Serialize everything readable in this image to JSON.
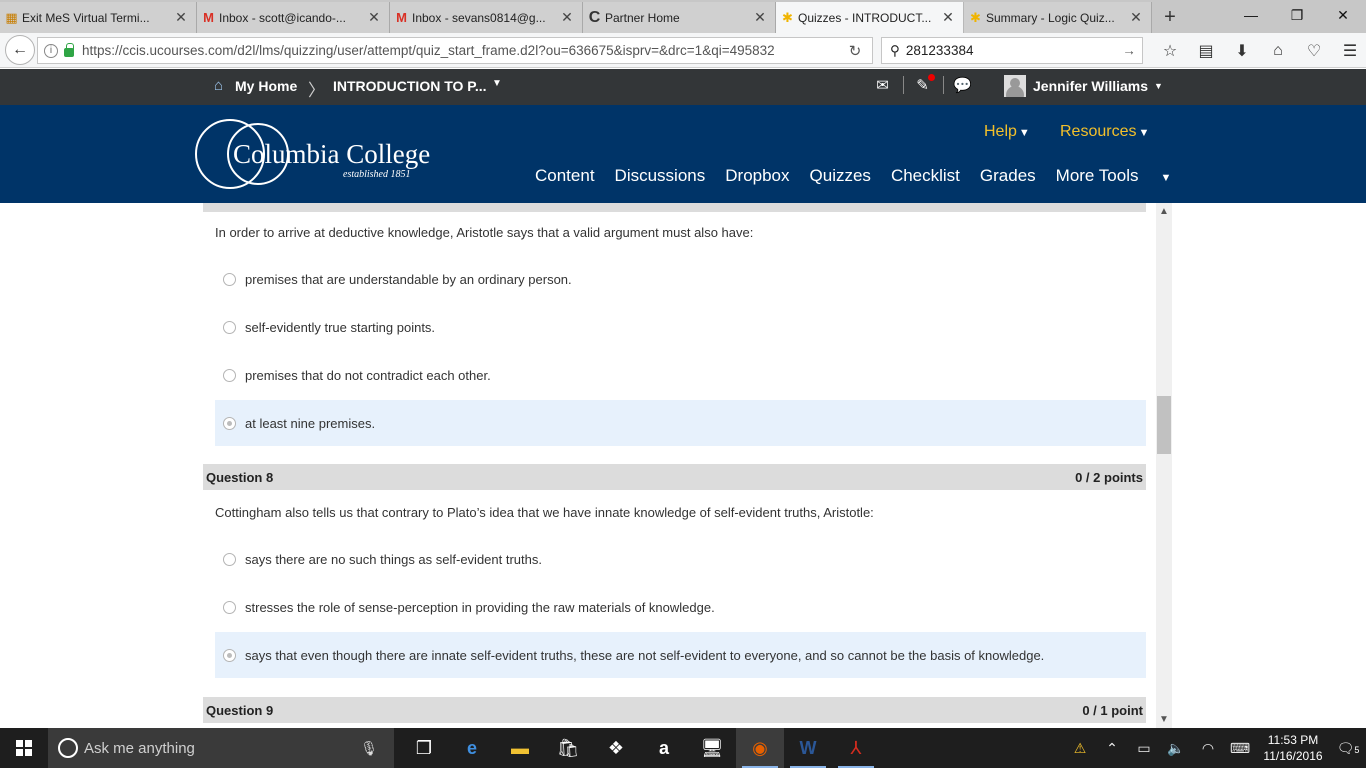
{
  "browser": {
    "tabs": [
      {
        "icon": "terminal-icon",
        "title": "Exit MeS Virtual Termi...",
        "active": false
      },
      {
        "icon": "gmail-icon",
        "title": "Inbox - scott@icando-...",
        "active": false
      },
      {
        "icon": "gmail-icon",
        "title": "Inbox - sevans0814@g...",
        "active": false
      },
      {
        "icon": "c-logo-icon",
        "title": "Partner Home",
        "active": false
      },
      {
        "icon": "d2l-icon",
        "title": "Quizzes - INTRODUCT...",
        "active": true
      },
      {
        "icon": "d2l-icon",
        "title": "Summary - Logic Quiz...",
        "active": false
      }
    ],
    "url": "https://ccis.ucourses.com/d2l/lms/quizzing/user/attempt/quiz_start_frame.d2l?ou=636675&isprv=&drc=1&qi=495832",
    "search_value": "281233384"
  },
  "minibar": {
    "home_label": "My Home",
    "course_label": "INTRODUCTION TO P...",
    "user_name": "Jennifer Williams"
  },
  "header": {
    "logo_text": "Columbia College",
    "logo_sub": "established 1851",
    "help_label": "Help",
    "resources_label": "Resources",
    "nav": [
      "Content",
      "Discussions",
      "Dropbox",
      "Quizzes",
      "Checklist",
      "Grades",
      "More Tools"
    ]
  },
  "quiz": {
    "q7": {
      "text": "In order to arrive at deductive knowledge, Aristotle says that a valid argument must also have:",
      "options": [
        "premises that are understandable by an ordinary person.",
        "self-evidently true starting points.",
        "premises that do not contradict each other.",
        "at least nine premises."
      ],
      "selected_index": 3
    },
    "q8": {
      "title": "Question 8",
      "points": "0 / 2 points",
      "text": "Cottingham also tells us that contrary to Plato’s idea that we have innate knowledge of self-evident truths, Aristotle:",
      "options": [
        "says there are no such things as self-evident truths.",
        "stresses the role of sense-perception in providing the raw materials of knowledge.",
        "says that even though there are innate self-evident truths, these are not self-evident to everyone, and so cannot be the basis of knowledge."
      ],
      "selected_index": 2
    },
    "q9": {
      "title": "Question 9",
      "points": "0 / 1 point"
    }
  },
  "taskbar": {
    "search_placeholder": "Ask me anything",
    "time": "11:53 PM",
    "date": "11/16/2016",
    "notification_count": "5"
  }
}
